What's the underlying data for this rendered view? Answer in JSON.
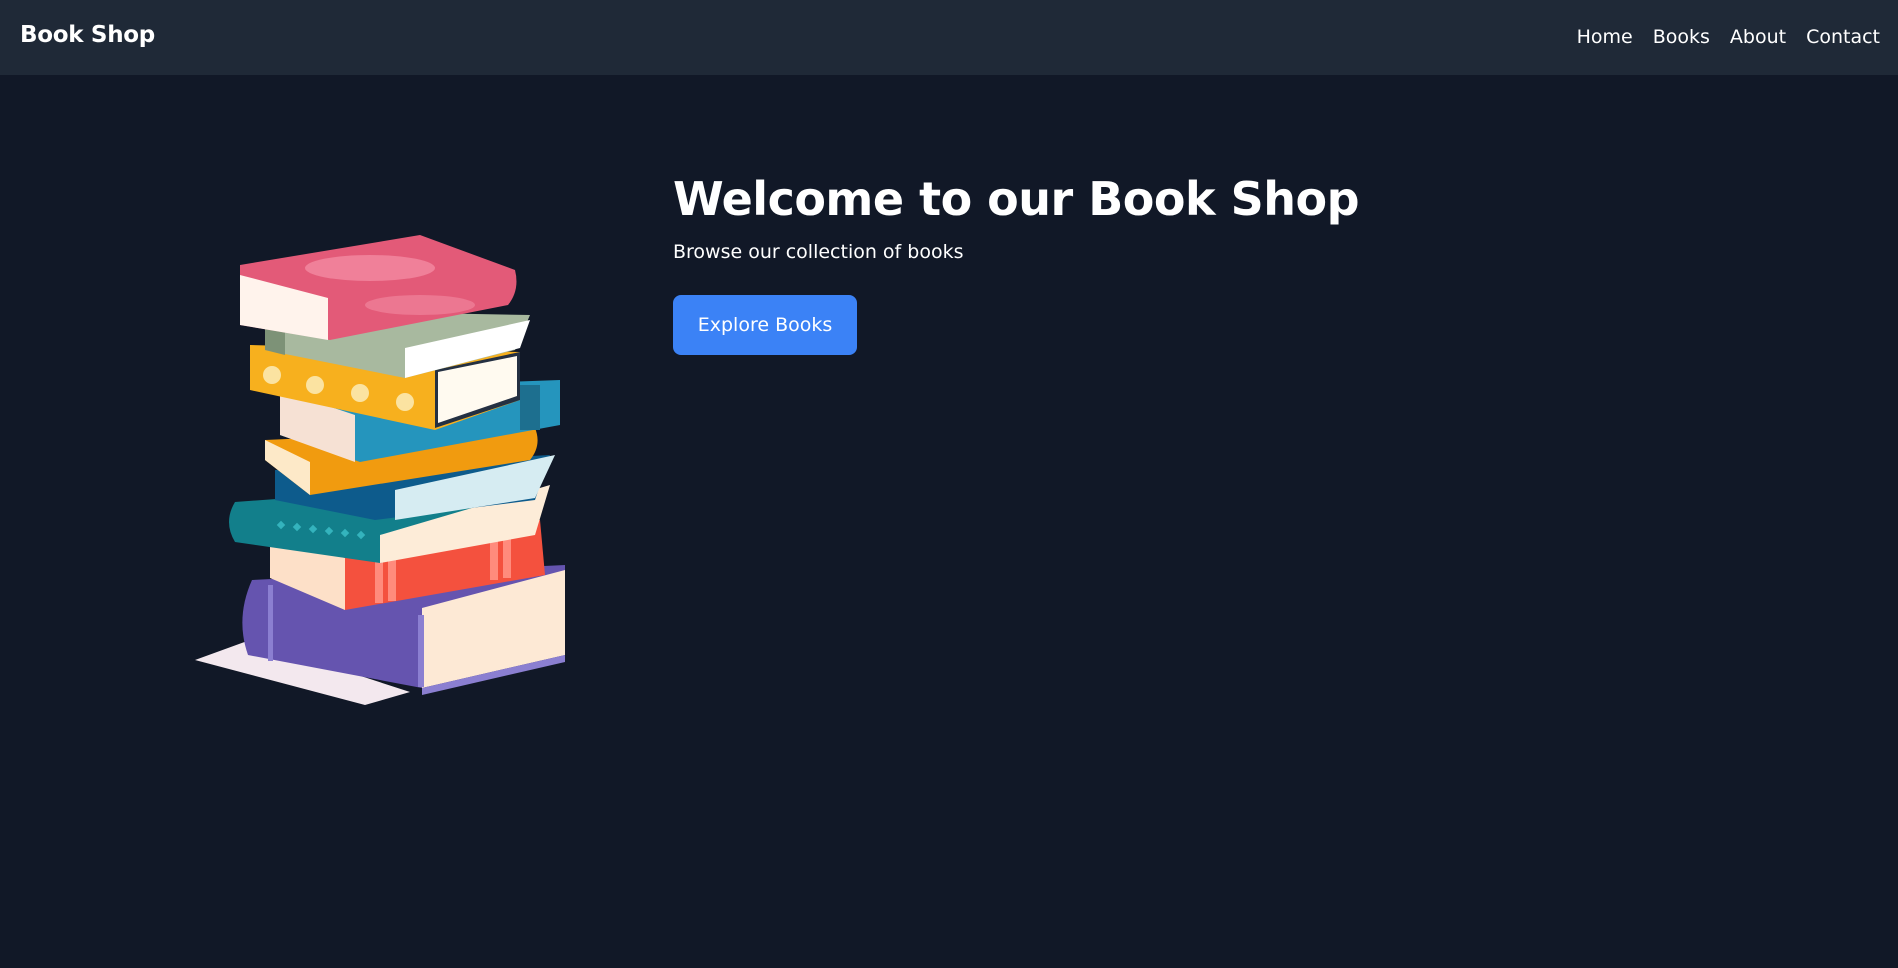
{
  "nav": {
    "brand": "Book Shop",
    "links": [
      "Home",
      "Books",
      "About",
      "Contact"
    ]
  },
  "hero": {
    "title": "Welcome to our Book Shop",
    "subtitle": "Browse our collection of books",
    "cta_label": "Explore Books",
    "illustration_icon": "stack-of-books-icon"
  },
  "colors": {
    "background": "#111827",
    "navbar": "#1f2937",
    "accent": "#3b82f6",
    "text": "#ffffff"
  }
}
